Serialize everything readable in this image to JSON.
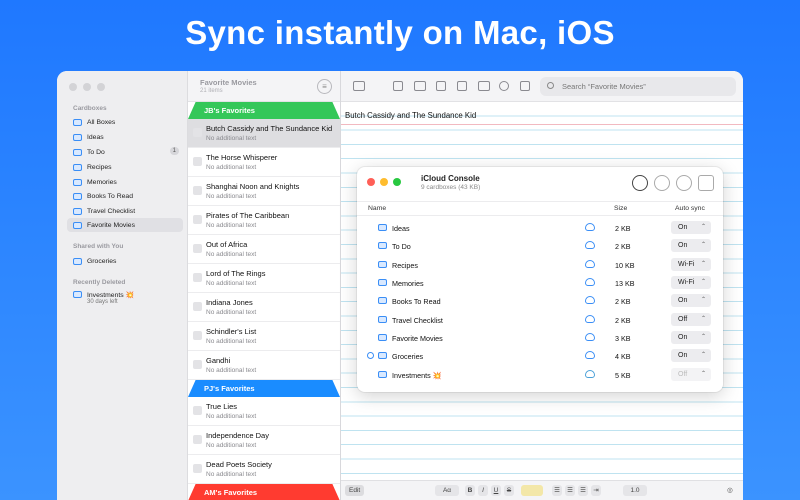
{
  "headline": "Sync instantly on Mac, iOS",
  "sidebar": {
    "sections": {
      "cardboxes": "Cardboxes",
      "shared": "Shared with You",
      "deleted": "Recently Deleted"
    },
    "items": [
      {
        "label": "All Boxes"
      },
      {
        "label": "Ideas"
      },
      {
        "label": "To Do",
        "badge": "1"
      },
      {
        "label": "Recipes"
      },
      {
        "label": "Memories"
      },
      {
        "label": "Books To Read"
      },
      {
        "label": "Travel Checklist"
      },
      {
        "label": "Favorite Movies"
      }
    ],
    "shared_items": [
      {
        "label": "Groceries"
      }
    ],
    "deleted_items": [
      {
        "label": "Investments 💥",
        "sub": "30 days left"
      }
    ]
  },
  "list": {
    "title": "Favorite Movies",
    "count": "21 items",
    "groups": [
      {
        "name": "JB's Favorites",
        "color": "#34c759"
      },
      {
        "name": "PJ's Favorites",
        "color": "#1a8cff"
      },
      {
        "name": "AM's Favorites",
        "color": "#ff3b30"
      }
    ],
    "cards": [
      {
        "title": "Butch Cassidy and The Sundance Kid",
        "sub": "No additional text"
      },
      {
        "title": "The Horse Whisperer",
        "sub": "No additional text"
      },
      {
        "title": "Shanghai Noon and Knights",
        "sub": "No additional text"
      },
      {
        "title": "Pirates of The Caribbean",
        "sub": "No additional text"
      },
      {
        "title": "Out of Africa",
        "sub": "No additional text"
      },
      {
        "title": "Lord of The Rings",
        "sub": "No additional text"
      },
      {
        "title": "Indiana Jones",
        "sub": "No additional text"
      },
      {
        "title": "Schindler's List",
        "sub": "No additional text"
      },
      {
        "title": "Gandhi",
        "sub": "No additional text"
      },
      {
        "title": "True Lies",
        "sub": "No additional text"
      },
      {
        "title": "Independence Day",
        "sub": "No additional text"
      },
      {
        "title": "Dead Poets Society",
        "sub": "No additional text"
      }
    ]
  },
  "detail": {
    "search_placeholder": "Search “Favorite Movies”",
    "note_title": "Butch Cassidy and The Sundance Kid",
    "edit_label": "Edit",
    "font_label": "Aα",
    "bold": "B",
    "italic": "I",
    "underline": "U",
    "strike": "S",
    "spacing": "1.0"
  },
  "console": {
    "title": "iCloud Console",
    "subtitle": "9 cardboxes (43 KB)",
    "col_name": "Name",
    "col_size": "Size",
    "col_sync": "Auto sync",
    "rows": [
      {
        "name": "Ideas",
        "size": "2 KB",
        "sync": "On"
      },
      {
        "name": "To Do",
        "size": "2 KB",
        "sync": "On"
      },
      {
        "name": "Recipes",
        "size": "10 KB",
        "sync": "Wi-Fi"
      },
      {
        "name": "Memories",
        "size": "13 KB",
        "sync": "Wi-Fi"
      },
      {
        "name": "Books To Read",
        "size": "2 KB",
        "sync": "On"
      },
      {
        "name": "Travel Checklist",
        "size": "2 KB",
        "sync": "Off"
      },
      {
        "name": "Favorite Movies",
        "size": "3 KB",
        "sync": "On"
      },
      {
        "name": "Groceries",
        "size": "4 KB",
        "sync": "On"
      },
      {
        "name": "Investments 💥",
        "size": "5 KB",
        "sync": "Off"
      }
    ]
  }
}
